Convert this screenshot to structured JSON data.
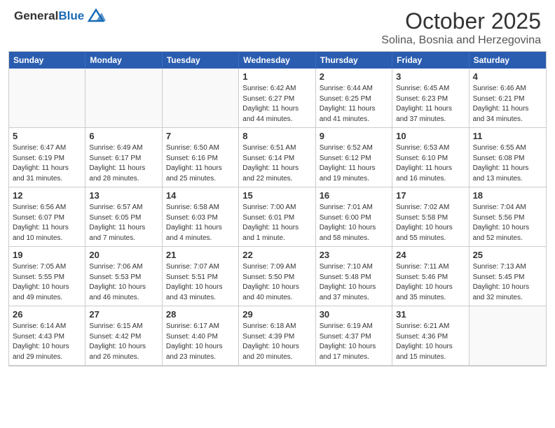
{
  "header": {
    "logo_general": "General",
    "logo_blue": "Blue",
    "month": "October 2025",
    "location": "Solina, Bosnia and Herzegovina"
  },
  "calendar": {
    "days_of_week": [
      "Sunday",
      "Monday",
      "Tuesday",
      "Wednesday",
      "Thursday",
      "Friday",
      "Saturday"
    ],
    "weeks": [
      [
        {
          "day": "",
          "info": ""
        },
        {
          "day": "",
          "info": ""
        },
        {
          "day": "",
          "info": ""
        },
        {
          "day": "1",
          "info": "Sunrise: 6:42 AM\nSunset: 6:27 PM\nDaylight: 11 hours\nand 44 minutes."
        },
        {
          "day": "2",
          "info": "Sunrise: 6:44 AM\nSunset: 6:25 PM\nDaylight: 11 hours\nand 41 minutes."
        },
        {
          "day": "3",
          "info": "Sunrise: 6:45 AM\nSunset: 6:23 PM\nDaylight: 11 hours\nand 37 minutes."
        },
        {
          "day": "4",
          "info": "Sunrise: 6:46 AM\nSunset: 6:21 PM\nDaylight: 11 hours\nand 34 minutes."
        }
      ],
      [
        {
          "day": "5",
          "info": "Sunrise: 6:47 AM\nSunset: 6:19 PM\nDaylight: 11 hours\nand 31 minutes."
        },
        {
          "day": "6",
          "info": "Sunrise: 6:49 AM\nSunset: 6:17 PM\nDaylight: 11 hours\nand 28 minutes."
        },
        {
          "day": "7",
          "info": "Sunrise: 6:50 AM\nSunset: 6:16 PM\nDaylight: 11 hours\nand 25 minutes."
        },
        {
          "day": "8",
          "info": "Sunrise: 6:51 AM\nSunset: 6:14 PM\nDaylight: 11 hours\nand 22 minutes."
        },
        {
          "day": "9",
          "info": "Sunrise: 6:52 AM\nSunset: 6:12 PM\nDaylight: 11 hours\nand 19 minutes."
        },
        {
          "day": "10",
          "info": "Sunrise: 6:53 AM\nSunset: 6:10 PM\nDaylight: 11 hours\nand 16 minutes."
        },
        {
          "day": "11",
          "info": "Sunrise: 6:55 AM\nSunset: 6:08 PM\nDaylight: 11 hours\nand 13 minutes."
        }
      ],
      [
        {
          "day": "12",
          "info": "Sunrise: 6:56 AM\nSunset: 6:07 PM\nDaylight: 11 hours\nand 10 minutes."
        },
        {
          "day": "13",
          "info": "Sunrise: 6:57 AM\nSunset: 6:05 PM\nDaylight: 11 hours\nand 7 minutes."
        },
        {
          "day": "14",
          "info": "Sunrise: 6:58 AM\nSunset: 6:03 PM\nDaylight: 11 hours\nand 4 minutes."
        },
        {
          "day": "15",
          "info": "Sunrise: 7:00 AM\nSunset: 6:01 PM\nDaylight: 11 hours\nand 1 minute."
        },
        {
          "day": "16",
          "info": "Sunrise: 7:01 AM\nSunset: 6:00 PM\nDaylight: 10 hours\nand 58 minutes."
        },
        {
          "day": "17",
          "info": "Sunrise: 7:02 AM\nSunset: 5:58 PM\nDaylight: 10 hours\nand 55 minutes."
        },
        {
          "day": "18",
          "info": "Sunrise: 7:04 AM\nSunset: 5:56 PM\nDaylight: 10 hours\nand 52 minutes."
        }
      ],
      [
        {
          "day": "19",
          "info": "Sunrise: 7:05 AM\nSunset: 5:55 PM\nDaylight: 10 hours\nand 49 minutes."
        },
        {
          "day": "20",
          "info": "Sunrise: 7:06 AM\nSunset: 5:53 PM\nDaylight: 10 hours\nand 46 minutes."
        },
        {
          "day": "21",
          "info": "Sunrise: 7:07 AM\nSunset: 5:51 PM\nDaylight: 10 hours\nand 43 minutes."
        },
        {
          "day": "22",
          "info": "Sunrise: 7:09 AM\nSunset: 5:50 PM\nDaylight: 10 hours\nand 40 minutes."
        },
        {
          "day": "23",
          "info": "Sunrise: 7:10 AM\nSunset: 5:48 PM\nDaylight: 10 hours\nand 37 minutes."
        },
        {
          "day": "24",
          "info": "Sunrise: 7:11 AM\nSunset: 5:46 PM\nDaylight: 10 hours\nand 35 minutes."
        },
        {
          "day": "25",
          "info": "Sunrise: 7:13 AM\nSunset: 5:45 PM\nDaylight: 10 hours\nand 32 minutes."
        }
      ],
      [
        {
          "day": "26",
          "info": "Sunrise: 6:14 AM\nSunset: 4:43 PM\nDaylight: 10 hours\nand 29 minutes."
        },
        {
          "day": "27",
          "info": "Sunrise: 6:15 AM\nSunset: 4:42 PM\nDaylight: 10 hours\nand 26 minutes."
        },
        {
          "day": "28",
          "info": "Sunrise: 6:17 AM\nSunset: 4:40 PM\nDaylight: 10 hours\nand 23 minutes."
        },
        {
          "day": "29",
          "info": "Sunrise: 6:18 AM\nSunset: 4:39 PM\nDaylight: 10 hours\nand 20 minutes."
        },
        {
          "day": "30",
          "info": "Sunrise: 6:19 AM\nSunset: 4:37 PM\nDaylight: 10 hours\nand 17 minutes."
        },
        {
          "day": "31",
          "info": "Sunrise: 6:21 AM\nSunset: 4:36 PM\nDaylight: 10 hours\nand 15 minutes."
        },
        {
          "day": "",
          "info": ""
        }
      ]
    ]
  }
}
